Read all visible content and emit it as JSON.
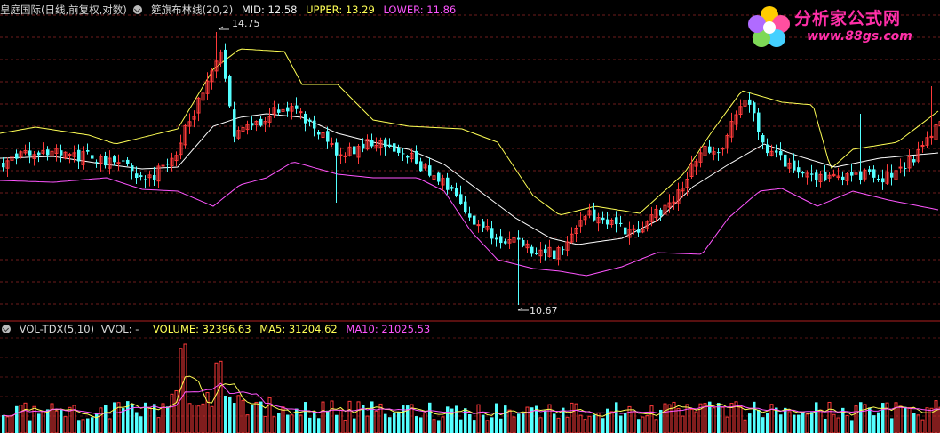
{
  "price_panel": {
    "stock_name": "皇庭国际(日线,前复权,对数)",
    "indicator_name": "筵旗布林线(20,2)",
    "mid_label": "MID: 12.58",
    "upper_label": "UPPER: 13.29",
    "lower_label": "LOWER: 11.86"
  },
  "volume_panel": {
    "indicator_name": "VOL-TDX(5,10)",
    "vvol_label": "VVOL: -",
    "volume_label": "VOLUME: 32396.63",
    "ma5_label": "MA5: 31204.62",
    "ma10_label": "MA10: 21025.53"
  },
  "watermark": {
    "title": "分析家公式网",
    "url": "www.88gs.com"
  },
  "colors": {
    "background": "#000000",
    "up_candle": "#ff3a3a",
    "down_candle": "#54ffff",
    "mid_line": "#ffffff",
    "upper_line": "#ffff55",
    "lower_line": "#ff55ff",
    "grid": "#7a1e1e",
    "header_text": "#d8d8d8",
    "watermark": "#ff2fa8"
  },
  "chart_data": {
    "type": "candlestick",
    "price_scale": "log",
    "annotations": [
      {
        "label": "14.75",
        "value": 14.75,
        "kind": "high"
      },
      {
        "label": "10.67",
        "value": 10.67,
        "kind": "low"
      }
    ],
    "mid": 12.58,
    "upper": 13.29,
    "lower": 11.86,
    "volume": 32396.63,
    "ma5": 31204.62,
    "ma10": 21025.53,
    "grid": true
  }
}
